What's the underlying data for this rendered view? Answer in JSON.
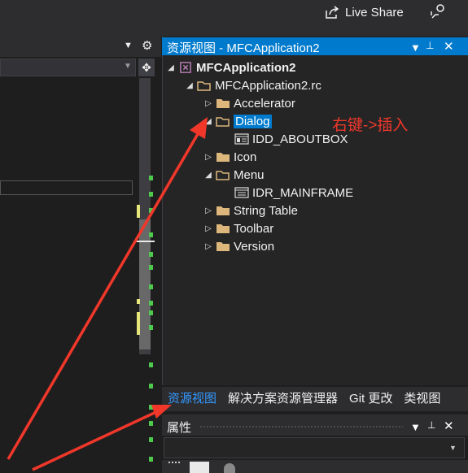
{
  "topbar": {
    "live_share_label": "Live Share"
  },
  "panel": {
    "title": "资源视图 - MFCApplication2",
    "controls": {
      "menu": "▼",
      "pin": "📌",
      "close": "✕"
    }
  },
  "tree": {
    "project": "MFCApplication2",
    "rc_file": "MFCApplication2.rc",
    "accelerator": "Accelerator",
    "dialog": "Dialog",
    "dialog_child": "IDD_ABOUTBOX",
    "icon": "Icon",
    "menu": "Menu",
    "menu_child": "IDR_MAINFRAME",
    "string_table": "String Table",
    "toolbar": "Toolbar",
    "version": "Version"
  },
  "annotation": "右键->插入",
  "tabs": [
    "资源视图",
    "解决方案资源管理器",
    "Git 更改",
    "类视图"
  ],
  "properties": {
    "title": "属性"
  },
  "colors": {
    "accent": "#007acc",
    "annotation_red": "#f0372a",
    "folder": "#dcb67a",
    "marker_green": "#4ec94e",
    "marker_yellow": "#e6e67a"
  }
}
